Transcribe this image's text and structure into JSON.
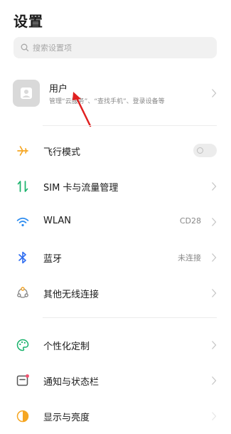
{
  "page": {
    "title": "设置"
  },
  "search": {
    "placeholder": "搜索设置项"
  },
  "account": {
    "name": "用户",
    "description": "管理“云服务”、“查找手机”、登录设备等"
  },
  "rows": [
    {
      "label": "飞行模式",
      "icon": "airplane-icon",
      "control": "toggle",
      "toggle_on": false
    },
    {
      "label": "SIM 卡与流量管理",
      "icon": "sim-data-icon"
    },
    {
      "label": "WLAN",
      "icon": "wifi-icon",
      "value": "CD28"
    },
    {
      "label": "蓝牙",
      "icon": "bluetooth-icon",
      "value": "未连接"
    },
    {
      "label": "其他无线连接",
      "icon": "wireless-connections-icon"
    },
    {
      "label": "个性化定制",
      "icon": "palette-icon"
    },
    {
      "label": "通知与状态栏",
      "icon": "notification-icon"
    },
    {
      "label": "显示与亮度",
      "icon": "brightness-icon"
    }
  ],
  "colors": {
    "airplane": "#f5a623",
    "sim": "#18b26b",
    "wifi": "#2d8cf0",
    "bluetooth": "#2d6cf0",
    "wireless": "#f0a020",
    "palette": "#18b26b",
    "notification": "#555555",
    "notification_dot": "#f0506e",
    "brightness": "#f5a623",
    "annotation_arrow": "#e02020"
  }
}
